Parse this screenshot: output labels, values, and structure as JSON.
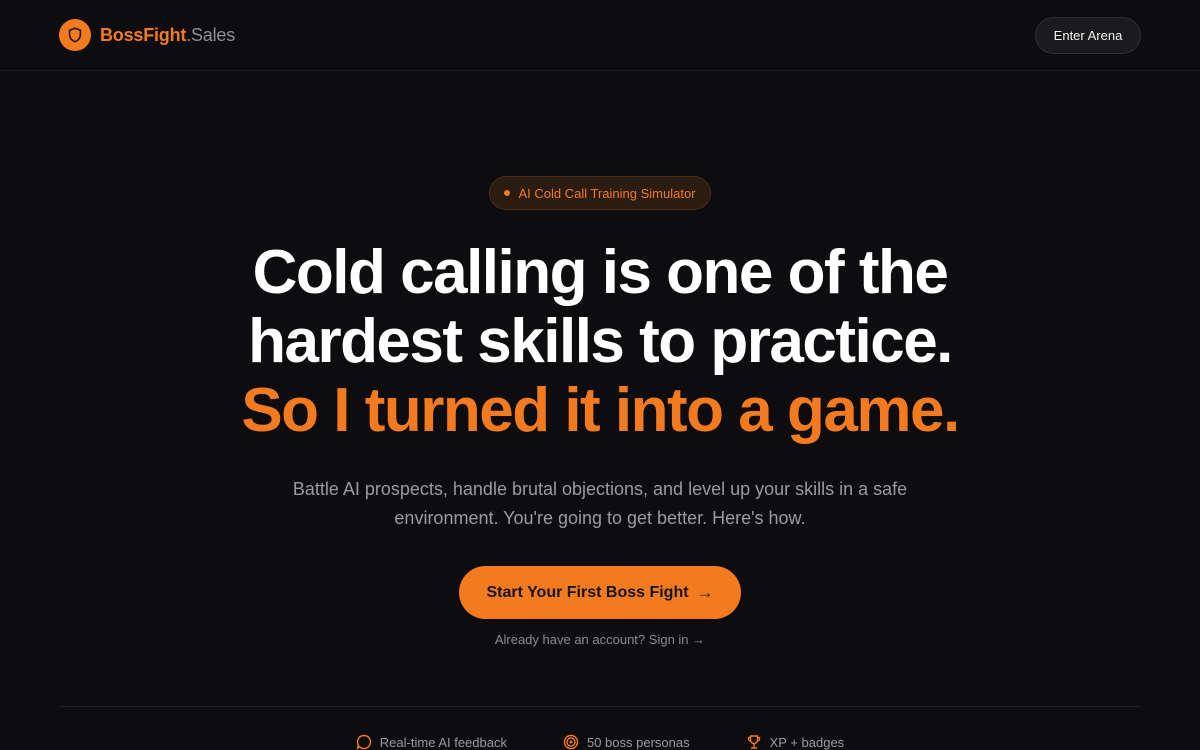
{
  "header": {
    "brand_name": "BossFight",
    "brand_suffix": ".Sales",
    "enter_label": "Enter Arena"
  },
  "hero": {
    "badge": "AI Cold Call Training Simulator",
    "headline_line1": "Cold calling is one of the",
    "headline_line2": "hardest skills to practice.",
    "headline_line3": "So I turned it into a game.",
    "subtext": "Battle AI prospects, handle brutal objections, and level up your skills in a safe environment. You're going to get better. Here's how.",
    "cta_label": "Start Your First Boss Fight",
    "cta_arrow": "→",
    "signin_prefix": "Already have an account?",
    "signin_link": "Sign in →"
  },
  "features": [
    {
      "label": "Real-time AI feedback",
      "icon": "message-circle-icon"
    },
    {
      "label": "50 boss personas",
      "icon": "target-icon"
    },
    {
      "label": "XP + badges",
      "icon": "trophy-icon"
    }
  ],
  "colors": {
    "accent": "#f47a1f",
    "background": "#0d0d0f"
  }
}
